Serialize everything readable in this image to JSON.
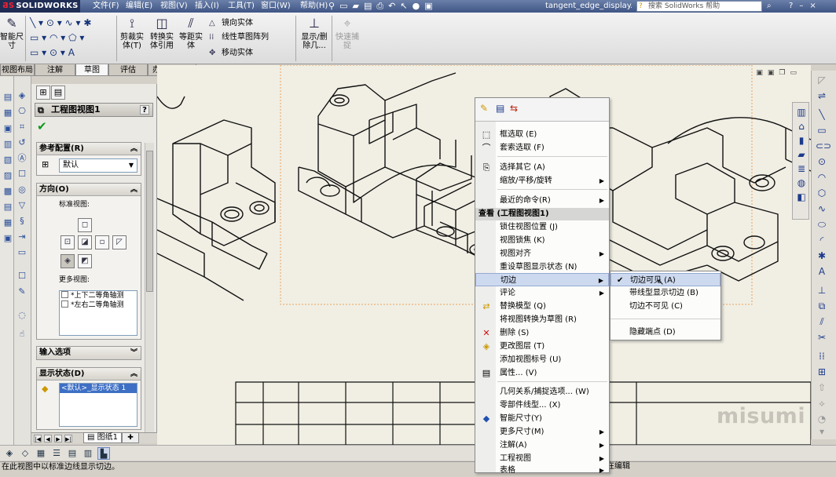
{
  "app": {
    "logo": "SOLIDWORKS",
    "doc_name": "tangent_edge_display..."
  },
  "menubar": [
    "文件(F)",
    "编辑(E)",
    "视图(V)",
    "插入(I)",
    "工具(T)",
    "窗口(W)",
    "帮助(H)"
  ],
  "help_search": {
    "placeholder": "搜索 SolidWorks 帮助"
  },
  "ribbon": {
    "smart_dim": "智能尺寸",
    "crop_view": "剪裁实体(T)",
    "convert": "转换实体引用",
    "offset": "等距实体",
    "mirror": "镜向实体",
    "linear_pattern": "线性草图阵列",
    "move": "移动实体",
    "display_delete": "显示/删除几...",
    "quick_snap": "快速捕捉"
  },
  "tabs": [
    "视图布局",
    "注解",
    "草图",
    "评估",
    "办公室产品"
  ],
  "active_tab": "草图",
  "property_manager": {
    "title": "工程图视图1",
    "help": "?",
    "ref_config": {
      "header": "参考配置(R)",
      "value": "默认"
    },
    "orientation": {
      "header": "方向(O)",
      "standard_views": "标准视图:",
      "more_views": "更多视图:",
      "more_list": [
        "*上下二等角轴测",
        "*左右二等角轴测"
      ]
    },
    "import_options": {
      "header": "输入选项"
    },
    "display_state": {
      "header": "显示状态(D)",
      "item": "<默认>_显示状态 1"
    }
  },
  "sheet_tab": "图纸1",
  "status": {
    "left": "在此视图中以标准边线显示切边。",
    "right": "在编辑"
  },
  "watermark": "misumi",
  "context_menu": {
    "group1": [
      {
        "label": "框选取 (E)",
        "sub": false
      },
      {
        "label": "套索选取 (F)",
        "sub": false
      },
      {
        "label": "选择其它 (A)",
        "sub": false
      },
      {
        "label": "缩放/平移/旋转",
        "sub": true
      },
      {
        "label": "最近的命令(R)",
        "sub": true
      }
    ],
    "section_header": "查看 (工程图视图1)",
    "group2": [
      {
        "label": "锁住视图位置 (J)",
        "sub": false
      },
      {
        "label": "视图锁焦 (K)",
        "sub": false
      },
      {
        "label": "视图对齐",
        "sub": true
      },
      {
        "label": "重设草图显示状态 (N)",
        "sub": false
      },
      {
        "label": "切边",
        "sub": true
      },
      {
        "label": "评论",
        "sub": true
      },
      {
        "label": "替换模型 (Q)",
        "sub": false
      },
      {
        "label": "将视图转换为草图 (R)",
        "sub": false
      },
      {
        "label": "删除 (S)",
        "sub": false
      },
      {
        "label": "更改图层 (T)",
        "sub": false
      },
      {
        "label": "添加视图标号 (U)",
        "sub": false
      },
      {
        "label": "属性... (V)",
        "sub": false
      }
    ],
    "group3": [
      {
        "label": "几何关系/捕捉选项... (W)",
        "sub": false
      },
      {
        "label": "零部件线型... (X)",
        "sub": false
      },
      {
        "label": "智能尺寸(Y)",
        "sub": false
      },
      {
        "label": "更多尺寸(M)",
        "sub": true
      },
      {
        "label": "注解(A)",
        "sub": true
      },
      {
        "label": "工程视图",
        "sub": true
      },
      {
        "label": "表格",
        "sub": true
      }
    ]
  },
  "submenu": {
    "items": [
      "切边可见 (A)",
      "带线型显示切边 (B)",
      "切边不可见 (C)",
      "隐藏端点 (D)"
    ],
    "checked": "切边可见 (A)"
  },
  "icons": {
    "delete": "red-x-icon",
    "check": "green-check-icon"
  }
}
